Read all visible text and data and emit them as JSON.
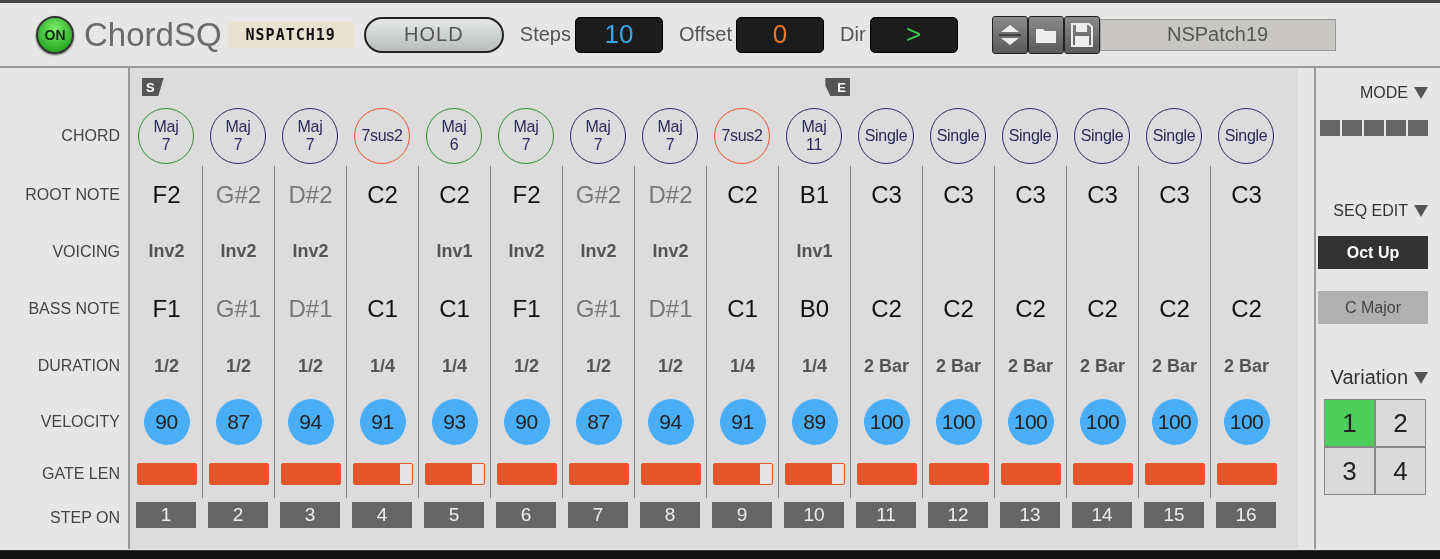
{
  "header": {
    "power": {
      "label": "ON",
      "on": true
    },
    "title": "ChordSQ",
    "patch_tag": "NSPATCH19",
    "hold_button": "HOLD",
    "readouts": [
      {
        "label": "Steps",
        "value": "10",
        "color": "#3aa6e8"
      },
      {
        "label": "Offset",
        "value": "0",
        "color": "#e8782a"
      },
      {
        "label": "Dir",
        "value": ">",
        "color": "#3ecf4a"
      }
    ],
    "patch_name": "NSPatch19"
  },
  "row_labels": [
    "CHORD",
    "ROOT NOTE",
    "VOICING",
    "BASS NOTE",
    "DURATION",
    "VELOCITY",
    "GATE LEN",
    "STEP ON"
  ],
  "steps": [
    {
      "marker": {
        "kind": "start",
        "label": "S"
      },
      "chord": "Maj\n7",
      "color": "#2e8b3a",
      "root": "F2",
      "dimmed": false,
      "voicing": "Inv2",
      "bass": "F1",
      "duration": "1/2",
      "velocity": "90",
      "level": 1,
      "number": "1"
    },
    {
      "chord": "Maj\n7",
      "color": "#2c2a5c",
      "root": "G#2",
      "dimmed": true,
      "voicing": "Inv2",
      "bass": "G#1",
      "duration": "1/2",
      "velocity": "87",
      "level": 1,
      "number": "2"
    },
    {
      "chord": "Maj\n7",
      "color": "#2c2a5c",
      "root": "D#2",
      "dimmed": true,
      "voicing": "Inv2",
      "bass": "D#1",
      "duration": "1/2",
      "velocity": "94",
      "level": 1,
      "number": "3"
    },
    {
      "chord": "7sus2",
      "color": "#e8542a",
      "root": "C2",
      "dimmed": false,
      "bass": "C1",
      "duration": "1/4",
      "velocity": "91",
      "level": 0.78,
      "number": "4"
    },
    {
      "chord": "Maj\n6",
      "color": "#2e8b3a",
      "root": "C2",
      "dimmed": false,
      "voicing": "Inv1",
      "bass": "C1",
      "duration": "1/4",
      "velocity": "93",
      "level": 0.78,
      "number": "5"
    },
    {
      "chord": "Maj\n7",
      "color": "#2e8b3a",
      "root": "F2",
      "dimmed": false,
      "voicing": "Inv2",
      "bass": "F1",
      "duration": "1/2",
      "velocity": "90",
      "level": 1,
      "number": "6"
    },
    {
      "chord": "Maj\n7",
      "color": "#2c2a5c",
      "root": "G#2",
      "dimmed": true,
      "voicing": "Inv2",
      "bass": "G#1",
      "duration": "1/2",
      "velocity": "87",
      "level": 1,
      "number": "7"
    },
    {
      "chord": "Maj\n7",
      "color": "#2c2a5c",
      "root": "D#2",
      "dimmed": true,
      "voicing": "Inv2",
      "bass": "D#1",
      "duration": "1/2",
      "velocity": "94",
      "level": 1,
      "number": "8"
    },
    {
      "chord": "7sus2",
      "color": "#e8542a",
      "root": "C2",
      "dimmed": false,
      "bass": "C1",
      "duration": "1/4",
      "velocity": "91",
      "level": 0.78,
      "number": "9"
    },
    {
      "marker": {
        "kind": "end",
        "label": "E"
      },
      "chord": "Maj\n11",
      "color": "#2c2a5c",
      "root": "B1",
      "dimmed": false,
      "voicing": "Inv1",
      "bass": "B0",
      "duration": "1/4",
      "velocity": "89",
      "level": 0.78,
      "number": "10"
    },
    {
      "chord": "Single",
      "color": "#2c2a5c",
      "root": "C3",
      "dimmed": false,
      "bass": "C2",
      "duration": "2 Bar",
      "velocity": "100",
      "level": 1,
      "number": "11"
    },
    {
      "chord": "Single",
      "color": "#2c2a5c",
      "root": "C3",
      "dimmed": false,
      "bass": "C2",
      "duration": "2 Bar",
      "velocity": "100",
      "level": 1,
      "number": "12"
    },
    {
      "chord": "Single",
      "color": "#2c2a5c",
      "root": "C3",
      "dimmed": false,
      "bass": "C2",
      "duration": "2 Bar",
      "velocity": "100",
      "level": 1,
      "number": "13"
    },
    {
      "chord": "Single",
      "color": "#2c2a5c",
      "root": "C3",
      "dimmed": false,
      "bass": "C2",
      "duration": "2 Bar",
      "velocity": "100",
      "level": 1,
      "number": "14"
    },
    {
      "chord": "Single",
      "color": "#2c2a5c",
      "root": "C3",
      "dimmed": false,
      "bass": "C2",
      "duration": "2 Bar",
      "velocity": "100",
      "level": 1,
      "number": "15"
    },
    {
      "chord": "Single",
      "color": "#2c2a5c",
      "root": "C3",
      "dimmed": false,
      "bass": "C2",
      "duration": "2 Bar",
      "velocity": "100",
      "level": 1,
      "number": "16"
    }
  ],
  "side_panel": {
    "mode_title": "MODE",
    "seq_edit_title": "SEQ EDIT",
    "seq_edit_options": [
      {
        "label": "Oct Up",
        "selected": true
      },
      {
        "label": "C Major",
        "selected": false
      }
    ],
    "variation_title": "Variation",
    "variations": [
      {
        "label": "1",
        "selected": true
      },
      {
        "label": "2",
        "selected": false
      },
      {
        "label": "3",
        "selected": false
      },
      {
        "label": "4",
        "selected": false
      }
    ]
  }
}
